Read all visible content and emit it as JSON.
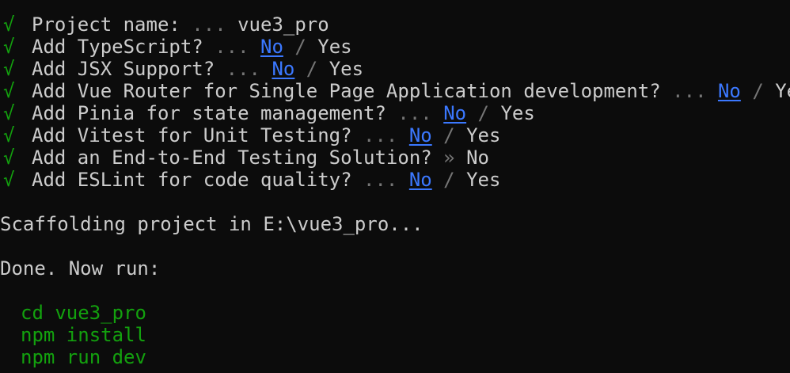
{
  "prompts": [
    {
      "question": "Project name:",
      "sep": " ... ",
      "answer": "vue3_pro",
      "type": "text"
    },
    {
      "question": "Add TypeScript?",
      "sep": " ... ",
      "no": "No",
      "slash": " / ",
      "yes": "Yes",
      "type": "choice"
    },
    {
      "question": "Add JSX Support?",
      "sep": " ... ",
      "no": "No",
      "slash": " / ",
      "yes": "Yes",
      "type": "choice"
    },
    {
      "question": "Add Vue Router for Single Page Application development?",
      "sep": " ... ",
      "no": "No",
      "slash": " / ",
      "yes": "Yes",
      "type": "choice"
    },
    {
      "question": "Add Pinia for state management?",
      "sep": " ... ",
      "no": "No",
      "slash": " / ",
      "yes": "Yes",
      "type": "choice"
    },
    {
      "question": "Add Vitest for Unit Testing?",
      "sep": " ... ",
      "no": "No",
      "slash": " / ",
      "yes": "Yes",
      "type": "choice"
    },
    {
      "question": "Add an End-to-End Testing Solution?",
      "sep": " » ",
      "answer": "No",
      "type": "final"
    },
    {
      "question": "Add ESLint for code quality?",
      "sep": " ... ",
      "no": "No",
      "slash": " / ",
      "yes": "Yes",
      "type": "choice"
    }
  ],
  "check_glyph": "√",
  "scaffolding": "Scaffolding project in E:\\vue3_pro...",
  "done": "Done. Now run:",
  "commands": [
    "cd vue3_pro",
    "npm install",
    "npm run dev"
  ],
  "colors": {
    "background": "#0c0c0c",
    "text": "#cccccc",
    "check": "#13a10e",
    "selected": "#3b78ff",
    "dim": "#767676",
    "command": "#13a10e"
  }
}
